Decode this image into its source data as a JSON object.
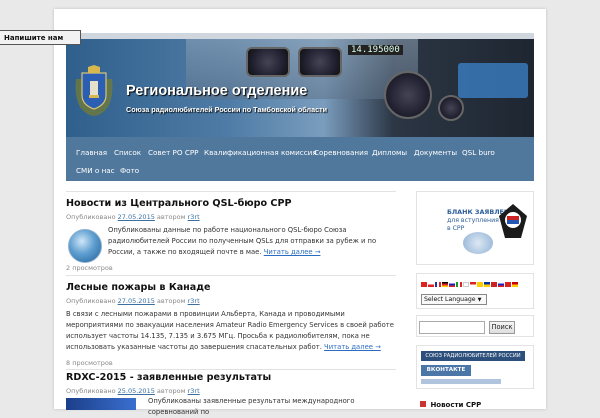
{
  "feedback_tab": "Напишите нам",
  "header": {
    "title": "Региональное отделение",
    "subtitle": "Союза радиолюбителей России по Тамбовской области",
    "freq_display": "14.195000"
  },
  "nav": {
    "items": [
      "Главная",
      "Список",
      "Совет РО СРР",
      "Квалификационная комиссия",
      "Соревнования",
      "Дипломы",
      "Документы",
      "QSL buro",
      "СМИ о нас",
      "Фото"
    ]
  },
  "articles": [
    {
      "title": "Новости из Центрального QSL-бюро СРР",
      "meta_prefix": "Опубликовано",
      "date": "27.05.2015",
      "author_prefix": "автором",
      "author": "r3rt",
      "text": "Опубликованы данные по работе национального QSL-бюро Союза радиолюбителей России по полученным QSLs для отправки за рубеж и по России, а также по входящей почте в мае.",
      "more": "Читать далее →",
      "footer": "2 просмотров"
    },
    {
      "title": "Лесные пожары в Канаде",
      "meta_prefix": "Опубликовано",
      "date": "27.05.2015",
      "author_prefix": "автором",
      "author": "r3rt",
      "text": "В связи с лесными пожарами в провинции Альберта, Канада и проводимыми мероприятиями по эвакуации населения Amateur Radio Emergency Services в своей работе использует частоты 14.135, 7.135 и 3.675 МГц. Просьба к радиолюбителям, пока не использовать указанные частоты до завершения спасательных работ.",
      "more": "Читать далее →",
      "footer": "8 просмотров"
    },
    {
      "title": "RDXC-2015 - заявленные результаты",
      "meta_prefix": "Опубликовано",
      "date": "25.05.2015",
      "author_prefix": "автором",
      "author": "r3rt",
      "text": "Опубликованы заявленные результаты международного соревнований по"
    }
  ],
  "sidebar": {
    "application": {
      "title": "БЛАНК ЗАЯВЛЕНИЯ",
      "line1": "для вступления",
      "line2": "в СРР"
    },
    "language_select": "Select Language",
    "search_button": "Поиск",
    "banner_srr": "СОЮЗ РАДИОЛЮБИТЕЛЕЙ РОССИИ",
    "banner_vk": "ВКОНТАКТЕ",
    "news_heading": "Новости СРР"
  },
  "colors": {
    "nav_bg": "#50779c",
    "link": "#2a6cc0"
  }
}
